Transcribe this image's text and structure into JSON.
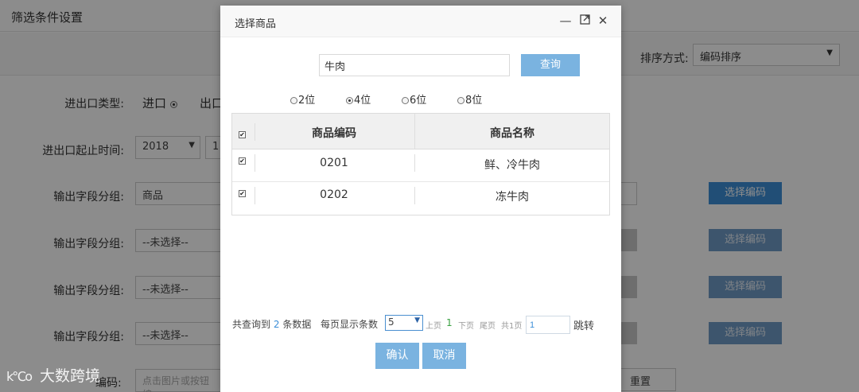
{
  "page": {
    "title": "筛选条件设置",
    "sort_label": "排序方式:",
    "sort_value": "编码排序",
    "import_export_label": "进出口类型:",
    "import_option": "进口",
    "export_option": "出口",
    "period_label": "进出口起止时间:",
    "year_value": "2018",
    "month_value": "1",
    "groups": [
      {
        "label": "输出字段分组:",
        "value": "商品",
        "button": "选择编码"
      },
      {
        "label": "输出字段分组:",
        "value": "--未选择--",
        "button": "选择编码"
      },
      {
        "label": "输出字段分组:",
        "value": "--未选择--",
        "button": "选择编码"
      },
      {
        "label": "输出字段分组:",
        "value": "--未选择--",
        "button": "选择编码"
      }
    ],
    "code_label_partial": "编码:",
    "code_placeholder": "点击图片或按钮编",
    "reset_label": "重置"
  },
  "watermark": {
    "logo": "k℃o",
    "text": "大数跨境"
  },
  "modal": {
    "title": "选择商品",
    "search_value": "牛肉",
    "query_label": "查询",
    "digit_options": [
      {
        "label": "2位",
        "selected": false
      },
      {
        "label": "4位",
        "selected": true
      },
      {
        "label": "6位",
        "selected": false
      },
      {
        "label": "8位",
        "selected": false
      }
    ],
    "columns": [
      "商品编码",
      "商品名称"
    ],
    "rows": [
      {
        "code": "0201",
        "name": "鲜、冷牛肉",
        "checked": true
      },
      {
        "code": "0202",
        "name": "冻牛肉",
        "checked": true
      }
    ],
    "pager": {
      "found_prefix": "共查询到",
      "found_count": "2",
      "found_suffix": "条数据",
      "perpage_label": "每页显示条数",
      "perpage_value": "5",
      "prev_label": "上页",
      "current_page": "1",
      "next_label": "下页",
      "last_label": "尾页",
      "total_label": "共1页",
      "jump_value": "1",
      "jump_label": "跳转"
    },
    "confirm_label": "确认",
    "cancel_label": "取消"
  },
  "colors": {
    "accent": "#7ab3e0",
    "button_blue": "#3d8fd8",
    "count_blue": "#3d8fd8",
    "page_green": "#3aa142"
  }
}
